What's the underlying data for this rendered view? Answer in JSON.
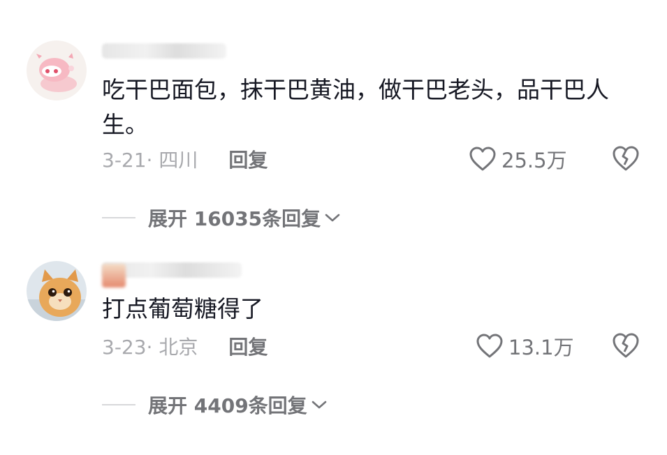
{
  "comments": [
    {
      "text": "吃干巴面包，抹干巴黄油，做干巴老头，品干巴人生。",
      "date_location": "3-21· 四川",
      "reply_label": "回复",
      "likes": "25.5万",
      "expand_label": "展开 16035条回复"
    },
    {
      "text": "打点葡萄糖得了",
      "date_location": "3-23· 北京",
      "reply_label": "回复",
      "likes": "13.1万",
      "expand_label": "展开 4409条回复"
    }
  ],
  "icons": {
    "like": "heart-outline-icon",
    "dislike": "broken-heart-icon",
    "expand": "chevron-down-icon"
  },
  "colors": {
    "text": "#161823",
    "secondary": "#737478",
    "muted": "#a8a9ad"
  }
}
